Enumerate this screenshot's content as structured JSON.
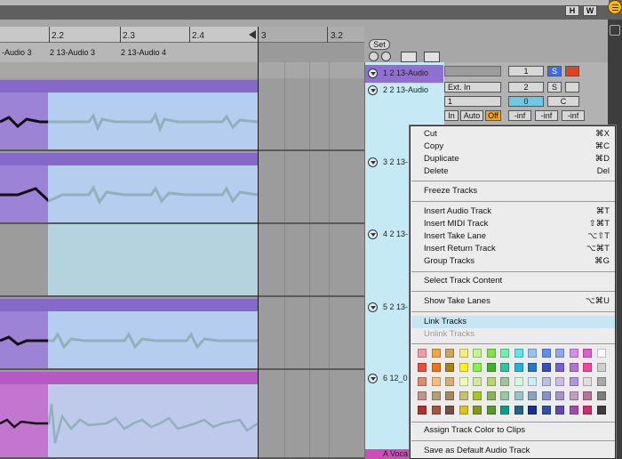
{
  "top_buttons": {
    "h": "H",
    "w": "W"
  },
  "ruler": {
    "ticks": [
      "2.2",
      "2.3",
      "2.4",
      "3",
      "3.2"
    ]
  },
  "arrangement": {
    "clip_labels": [
      "-Audio 3",
      "2 13-Audio 3",
      "2 13-Audio 4"
    ]
  },
  "set": {
    "label": "Set"
  },
  "tracks": [
    {
      "name": "1 2 13-Audio"
    },
    {
      "name": "2 2 13-Audio"
    },
    {
      "name": "3 2 13-"
    },
    {
      "name": "4 2 13-"
    },
    {
      "name": "5 2 13-"
    },
    {
      "name": "6 12_0"
    },
    {
      "name": "A Voca"
    }
  ],
  "mixer": {
    "row1": {
      "number": "1",
      "solo": "S"
    },
    "row2": {
      "input": "Ext. In",
      "number": "2",
      "solo": "S",
      "channel": "1",
      "volume": "0",
      "pan": "C"
    },
    "monitor": {
      "in": "In",
      "auto": "Auto",
      "off": "Off"
    },
    "sends": [
      "-inf",
      "-inf",
      "-inf"
    ]
  },
  "context_menu": {
    "items": [
      {
        "label": "Cut",
        "shortcut": "⌘X"
      },
      {
        "label": "Copy",
        "shortcut": "⌘C"
      },
      {
        "label": "Duplicate",
        "shortcut": "⌘D"
      },
      {
        "label": "Delete",
        "shortcut": "Del"
      },
      {
        "label": "Freeze Tracks",
        "shortcut": ""
      },
      {
        "label": "Insert Audio Track",
        "shortcut": "⌘T"
      },
      {
        "label": "Insert MIDI Track",
        "shortcut": "⇧⌘T"
      },
      {
        "label": "Insert Take Lane",
        "shortcut": "⌥⇧T"
      },
      {
        "label": "Insert Return Track",
        "shortcut": "⌥⌘T"
      },
      {
        "label": "Group Tracks",
        "shortcut": "⌘G"
      },
      {
        "label": "Select Track Content",
        "shortcut": ""
      },
      {
        "label": "Show Take Lanes",
        "shortcut": "⌥⌘U"
      },
      {
        "label": "Link Tracks",
        "shortcut": ""
      },
      {
        "label": "Unlink Tracks",
        "shortcut": ""
      },
      {
        "label": "Assign Track Color to Clips",
        "shortcut": ""
      },
      {
        "label": "Save as Default Audio Track",
        "shortcut": ""
      }
    ],
    "palette": [
      [
        "#f29aa6",
        "#f6a23e",
        "#d0a45a",
        "#f5ee7c",
        "#c7f490",
        "#80e34d",
        "#72f0b2",
        "#5de6e8",
        "#97c3f1",
        "#5f8ff0",
        "#94a4f0",
        "#d38ef0",
        "#e75bd0",
        "#ffffff"
      ],
      [
        "#ef4b3f",
        "#f27317",
        "#a9801a",
        "#fff124",
        "#88f249",
        "#3fb327",
        "#32c3a0",
        "#23b3dd",
        "#2479c6",
        "#3a4fb8",
        "#7b5ed8",
        "#b473d0",
        "#f24899",
        "#cfcfcf"
      ],
      [
        "#dd8a6e",
        "#ffbc7a",
        "#d9ae75",
        "#eeffb6",
        "#d2e79f",
        "#bad370",
        "#9ec997",
        "#d4fae4",
        "#cdeef9",
        "#b8c1e2",
        "#cdbde5",
        "#ad97e0",
        "#e4dce0",
        "#a9a9a9"
      ],
      [
        "#c5938d",
        "#b59d76",
        "#a4875b",
        "#c3bf73",
        "#a9c32b",
        "#88b558",
        "#94c8ac",
        "#9dc3ca",
        "#86a5c1",
        "#8392cb",
        "#a596c4",
        "#bf9fbe",
        "#bc7196",
        "#7b7b7b"
      ],
      [
        "#b0312d",
        "#a6533b",
        "#705143",
        "#dbc317",
        "#85971e",
        "#539a2f",
        "#0d9c8e",
        "#236383",
        "#1a2f96",
        "#2f52a2",
        "#624aad",
        "#a34bad",
        "#cc2e6e",
        "#3c3c3c"
      ]
    ]
  }
}
